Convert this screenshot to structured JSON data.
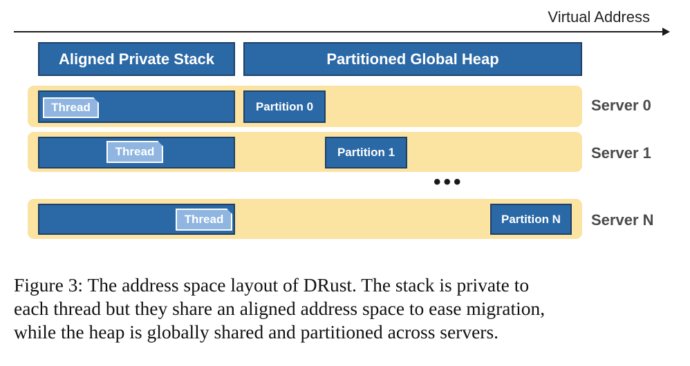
{
  "axis": {
    "label": "Virtual Address"
  },
  "headers": {
    "stack": "Aligned Private Stack",
    "heap": "Partitioned Global Heap"
  },
  "servers": [
    {
      "label": "Server 0",
      "thread": "Thread",
      "partition": "Partition 0"
    },
    {
      "label": "Server 1",
      "thread": "Thread",
      "partition": "Partition 1"
    },
    {
      "label": "Server N",
      "thread": "Thread",
      "partition": "Partition N"
    }
  ],
  "ellipsis": "•••",
  "caption": {
    "line1": "Figure 3: The address space layout of DRust. The stack is private to",
    "line2": "each thread but they share an aligned address space to ease migration,",
    "line3": "while the heap is globally shared and partitioned across servers."
  },
  "colors": {
    "block_blue": "#2a68a6",
    "block_border": "#1f3f66",
    "thread_light": "#8fb5e0",
    "server_band": "#fbe3a2",
    "server_label": "#4a4a4a"
  }
}
